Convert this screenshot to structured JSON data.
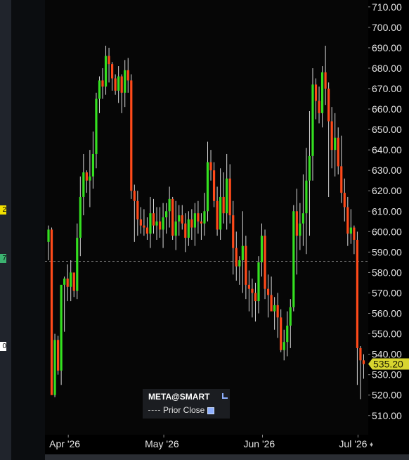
{
  "chart_data": {
    "type": "candlestick",
    "symbol": "META@SMART",
    "legend_item": "Prior Close",
    "ylim": [
      502,
      712
    ],
    "y_ticks": [
      510,
      520,
      530,
      540,
      550,
      560,
      570,
      580,
      590,
      600,
      610,
      620,
      630,
      640,
      650,
      660,
      670,
      680,
      690,
      700,
      710
    ],
    "y_tick_format": "{v}.00",
    "x_labels": [
      {
        "text": "Apr '26",
        "day": 6
      },
      {
        "text": "May '26",
        "day": 36
      },
      {
        "text": "Jun '26",
        "day": 67
      },
      {
        "text": "Jul '26",
        "day": 97
      }
    ],
    "last_price": "535.20",
    "last_price_value": 535.2,
    "prior_close": 585.5,
    "candles": [
      [
        595,
        603,
        586,
        601
      ],
      [
        601,
        602,
        521,
        520
      ],
      [
        520,
        550,
        519,
        547
      ],
      [
        547,
        549,
        530,
        532
      ],
      [
        532,
        569,
        525,
        574
      ],
      [
        574,
        578,
        551,
        577
      ],
      [
        577,
        584,
        566,
        573
      ],
      [
        573,
        586,
        566,
        580
      ],
      [
        580,
        574,
        568,
        571
      ],
      [
        571,
        604,
        567,
        597
      ],
      [
        597,
        627,
        588,
        617
      ],
      [
        617,
        638,
        608,
        629
      ],
      [
        629,
        630,
        619,
        625
      ],
      [
        625,
        640,
        612,
        627
      ],
      [
        627,
        649,
        621,
        638
      ],
      [
        638,
        668,
        631,
        665
      ],
      [
        665,
        676,
        658,
        674
      ],
      [
        674,
        680,
        665,
        671
      ],
      [
        671,
        691,
        667,
        686
      ],
      [
        686,
        690,
        673,
        682
      ],
      [
        682,
        683,
        669,
        675
      ],
      [
        675,
        677,
        667,
        669
      ],
      [
        669,
        681,
        663,
        676
      ],
      [
        676,
        677,
        658,
        668
      ],
      [
        668,
        684,
        661,
        679
      ],
      [
        679,
        685,
        668,
        674
      ],
      [
        674,
        677,
        616,
        620
      ],
      [
        620,
        623,
        595,
        615
      ],
      [
        615,
        620,
        598,
        606
      ],
      [
        606,
        612,
        599,
        603
      ],
      [
        603,
        611,
        598,
        602
      ],
      [
        602,
        607,
        596,
        599
      ],
      [
        599,
        617,
        592,
        609
      ],
      [
        609,
        616,
        599,
        603
      ],
      [
        603,
        612,
        596,
        605
      ],
      [
        605,
        612,
        597,
        601
      ],
      [
        601,
        614,
        592,
        607
      ],
      [
        607,
        614,
        599,
        610
      ],
      [
        610,
        622,
        602,
        616
      ],
      [
        616,
        617,
        596,
        598
      ],
      [
        598,
        615,
        591,
        605
      ],
      [
        605,
        613,
        598,
        608
      ],
      [
        608,
        613,
        601,
        604
      ],
      [
        604,
        609,
        590,
        597
      ],
      [
        597,
        610,
        593,
        606
      ],
      [
        606,
        611,
        596,
        602
      ],
      [
        602,
        614,
        593,
        609
      ],
      [
        609,
        615,
        599,
        605
      ],
      [
        605,
        609,
        596,
        604
      ],
      [
        604,
        619,
        598,
        610
      ],
      [
        610,
        644,
        605,
        634
      ],
      [
        634,
        640,
        625,
        630
      ],
      [
        630,
        634,
        612,
        615
      ],
      [
        615,
        622,
        598,
        601
      ],
      [
        601,
        631,
        596,
        617
      ],
      [
        617,
        629,
        604,
        609
      ],
      [
        609,
        638,
        601,
        626
      ],
      [
        626,
        633,
        604,
        608
      ],
      [
        608,
        615,
        579,
        592
      ],
      [
        592,
        600,
        576,
        583
      ],
      [
        583,
        588,
        574,
        586
      ],
      [
        586,
        610,
        570,
        593
      ],
      [
        593,
        598,
        567,
        574
      ],
      [
        574,
        581,
        561,
        572
      ],
      [
        572,
        577,
        558,
        570
      ],
      [
        570,
        575,
        556,
        566
      ],
      [
        566,
        588,
        560,
        585
      ],
      [
        585,
        604,
        578,
        598
      ],
      [
        598,
        601,
        567,
        572
      ],
      [
        572,
        579,
        558,
        569
      ],
      [
        569,
        578,
        563,
        561
      ],
      [
        561,
        568,
        552,
        564
      ],
      [
        564,
        570,
        548,
        558
      ],
      [
        558,
        562,
        541,
        542
      ],
      [
        542,
        552,
        537,
        546
      ],
      [
        546,
        561,
        539,
        554
      ],
      [
        554,
        567,
        543,
        563
      ],
      [
        563,
        613,
        561,
        610
      ],
      [
        610,
        621,
        579,
        598
      ],
      [
        598,
        614,
        591,
        604
      ],
      [
        604,
        628,
        593,
        609
      ],
      [
        609,
        641,
        589,
        625
      ],
      [
        625,
        659,
        598,
        637
      ],
      [
        637,
        680,
        625,
        672
      ],
      [
        672,
        675,
        655,
        664
      ],
      [
        664,
        671,
        653,
        658
      ],
      [
        658,
        681,
        651,
        678
      ],
      [
        678,
        691,
        662,
        670
      ],
      [
        670,
        673,
        617,
        654
      ],
      [
        654,
        661,
        631,
        640
      ],
      [
        640,
        658,
        627,
        646
      ],
      [
        646,
        651,
        628,
        632
      ],
      [
        632,
        647,
        614,
        619
      ],
      [
        619,
        626,
        605,
        612
      ],
      [
        612,
        617,
        593,
        599
      ],
      [
        599,
        611,
        594,
        602
      ],
      [
        602,
        603,
        589,
        596
      ],
      [
        596,
        600,
        525,
        543
      ],
      [
        543,
        544,
        518,
        537
      ],
      [
        537,
        540,
        528,
        535.2
      ]
    ]
  },
  "left_badges": [
    {
      "text": "2",
      "color": "#f2e000",
      "top": 292
    },
    {
      "text": "7",
      "color": "#3cb371",
      "top": 361
    },
    {
      "text": "0",
      "color": "#ffffff",
      "top": 486
    }
  ],
  "colors": {
    "up": "#34e020",
    "down": "#ff4a1a",
    "wick": "#d8d8d8",
    "axis_text": "#e6e6e6",
    "last_price_bg": "#d8d530",
    "last_price_text": "#1a1a00",
    "prior_close_line": "#7a7a7a"
  }
}
